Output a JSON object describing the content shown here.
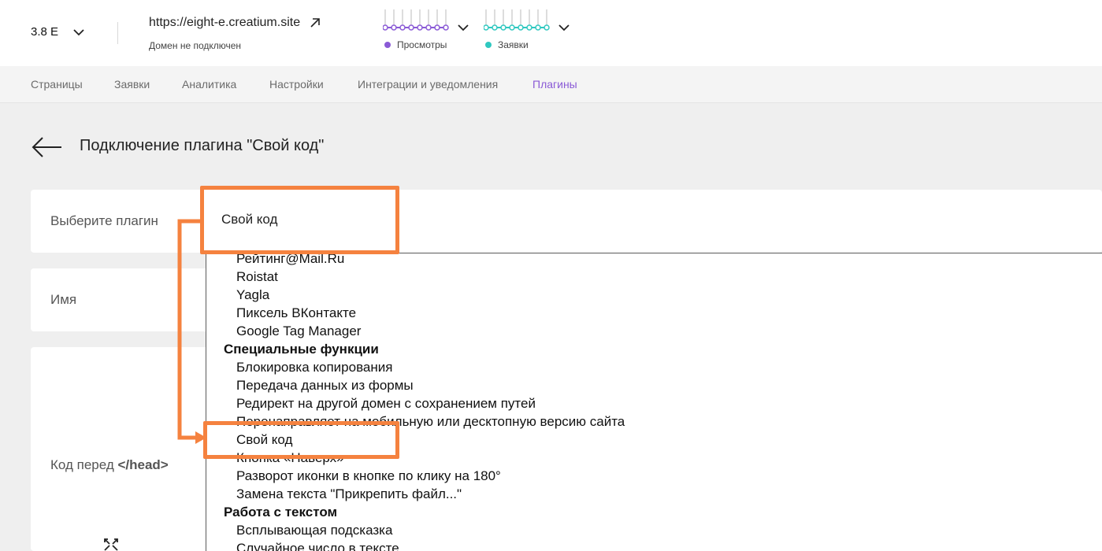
{
  "header": {
    "site_name": "3.8 E",
    "site_url": "https://eight-e.creatium.site",
    "domain_status": "Домен не подключен",
    "views_label": "Просмотры",
    "orders_label": "Заявки",
    "colors": {
      "views": "#8a5ad6",
      "orders": "#2fc8c0"
    }
  },
  "nav": {
    "items": [
      "Страницы",
      "Заявки",
      "Аналитика",
      "Настройки",
      "Интеграции и уведомления",
      "Плагины"
    ],
    "active": "Плагины"
  },
  "page": {
    "title": "Подключение плагина \"Свой код\""
  },
  "form": {
    "plugin_label": "Выберите плагин",
    "plugin_value": "Свой код",
    "name_label": "Имя",
    "code_label_prefix": "Код перед ",
    "code_label_tag": "</head>"
  },
  "dropdown": {
    "opt_0": "Рейтинг@Mail.Ru",
    "opt_1": "Roistat",
    "opt_2": "Yagla",
    "opt_3": "Пиксель ВКонтакте",
    "opt_4": "Google Tag Manager",
    "group_special": "Специальные функции",
    "opt_5": "Блокировка копирования",
    "opt_6": "Передача данных из формы",
    "opt_7": "Редирект на другой домен с сохранением путей",
    "opt_8": "Перенаправляет на мобильную или десктопную версию сайта",
    "opt_9": "Свой код",
    "opt_10": "Кнопка «Наверх»",
    "opt_11": "Разворот иконки в кнопке по клику на 180°",
    "opt_12": "Замена текста \"Прикрепить файл...\"",
    "group_text": "Работа с текстом",
    "opt_13": "Всплывающая подсказка",
    "opt_14": "Случайное число в тексте"
  },
  "annotation": {
    "color": "#f5823f"
  }
}
